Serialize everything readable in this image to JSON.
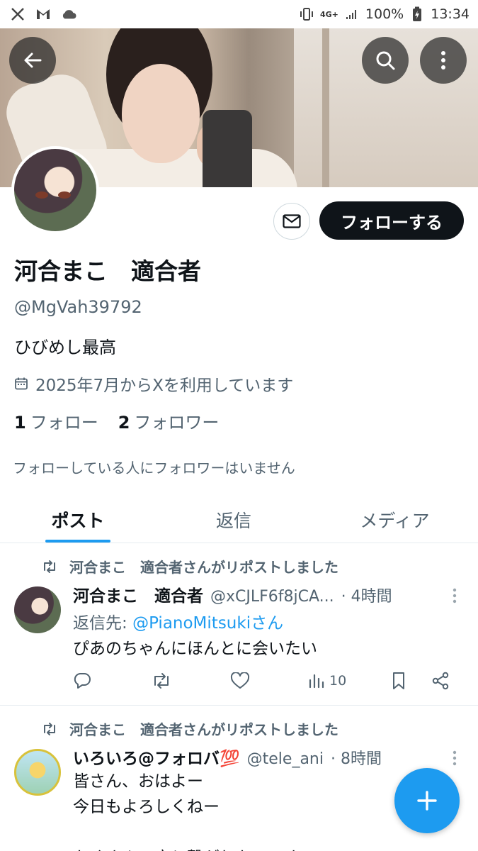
{
  "status_bar": {
    "battery": "100%",
    "time": "13:34",
    "network": "4G+"
  },
  "profile": {
    "display_name": "河合まこ　適合者",
    "handle": "@MgVah39792",
    "bio": "ひびめし最高",
    "joined": "2025年7月からXを利用しています",
    "following_count": "1",
    "following_label": "フォロー",
    "followers_count": "2",
    "followers_label": "フォロワー",
    "follow_note": "フォローしている人にフォロワーはいません",
    "follow_button": "フォローする"
  },
  "tabs": [
    {
      "label": "ポスト",
      "active": true
    },
    {
      "label": "返信",
      "active": false
    },
    {
      "label": "メディア",
      "active": false
    }
  ],
  "posts": [
    {
      "repost_text": "河合まこ　適合者さんがリポストしました",
      "author": "河合まこ　適合者",
      "handle": "@xCJLF6f8jCA...",
      "time": "· 4時間",
      "reply_prefix": "返信先: ",
      "reply_to": "@PianoMitsukiさん",
      "text": "ぴあのちゃんにほんとに会いたい",
      "views": "10"
    },
    {
      "repost_text": "河合まこ　適合者さんがリポストしました",
      "author": "いろいろ@フォロバ💯",
      "handle": "@tele_ani",
      "time": "· 8時間",
      "text": "皆さん、おはよー\n今日もよろしくねー\n\nたくさんの方と繋がりたいです"
    }
  ],
  "icons": {
    "back": "arrow-left-icon",
    "search": "search-icon",
    "more": "more-vertical-icon",
    "mail": "mail-icon",
    "calendar": "calendar-icon",
    "repost": "repost-icon",
    "reply": "reply-icon",
    "like": "heart-icon",
    "views": "views-icon",
    "bookmark": "bookmark-icon",
    "share": "share-icon",
    "compose": "plus-icon"
  },
  "colors": {
    "accent": "#1d9bf0",
    "text": "#0f1419",
    "secondary": "#536471",
    "follow_button_bg": "#0f1419"
  }
}
